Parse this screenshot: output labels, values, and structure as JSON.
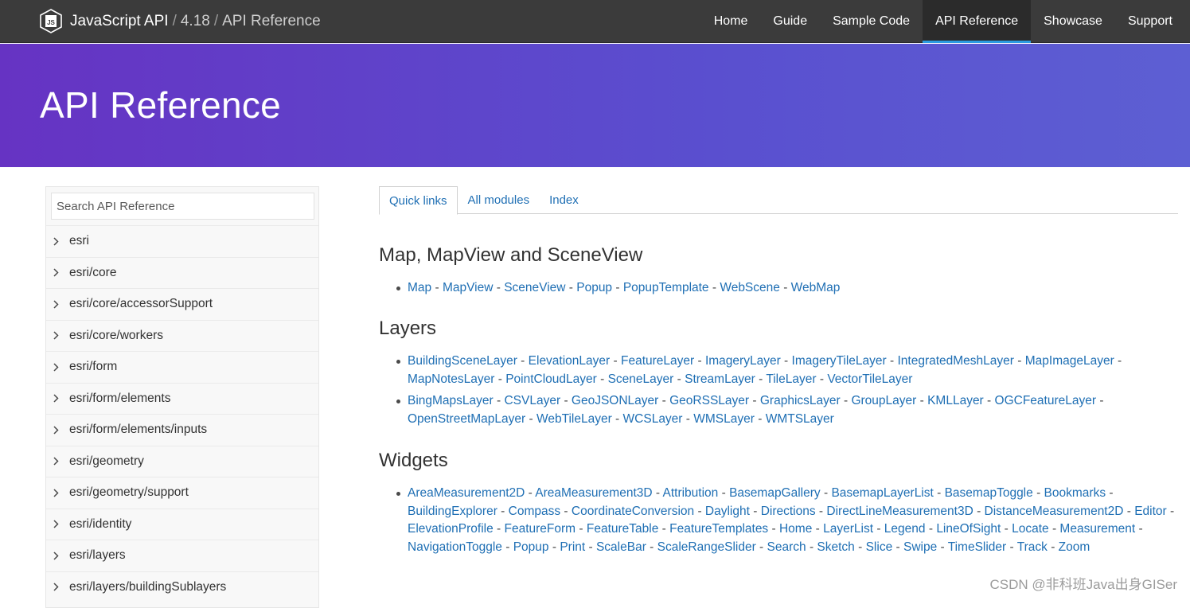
{
  "header": {
    "brand_title": "JavaScript API",
    "version": "4.18",
    "section": "API Reference",
    "separator": "/",
    "nav": [
      {
        "label": "Home",
        "active": false
      },
      {
        "label": "Guide",
        "active": false
      },
      {
        "label": "Sample Code",
        "active": false
      },
      {
        "label": "API Reference",
        "active": true
      },
      {
        "label": "Showcase",
        "active": false
      },
      {
        "label": "Support",
        "active": false
      }
    ]
  },
  "hero": {
    "title": "API Reference"
  },
  "sidebar": {
    "search_placeholder": "Search API Reference",
    "modules": [
      "esri",
      "esri/core",
      "esri/core/accessorSupport",
      "esri/core/workers",
      "esri/form",
      "esri/form/elements",
      "esri/form/elements/inputs",
      "esri/geometry",
      "esri/geometry/support",
      "esri/identity",
      "esri/layers",
      "esri/layers/buildingSublayers"
    ]
  },
  "main": {
    "tabs": [
      {
        "label": "Quick links",
        "active": true
      },
      {
        "label": "All modules",
        "active": false
      },
      {
        "label": "Index",
        "active": false
      }
    ],
    "sections": [
      {
        "title": "Map, MapView and SceneView",
        "groups": [
          [
            "Map",
            "MapView",
            "SceneView",
            "Popup",
            "PopupTemplate",
            "WebScene",
            "WebMap"
          ]
        ]
      },
      {
        "title": "Layers",
        "groups": [
          [
            "BuildingSceneLayer",
            "ElevationLayer",
            "FeatureLayer",
            "ImageryLayer",
            "ImageryTileLayer",
            "IntegratedMeshLayer",
            "MapImageLayer",
            "MapNotesLayer",
            "PointCloudLayer",
            "SceneLayer",
            "StreamLayer",
            "TileLayer",
            "VectorTileLayer"
          ],
          [
            "BingMapsLayer",
            "CSVLayer",
            "GeoJSONLayer",
            "GeoRSSLayer",
            "GraphicsLayer",
            "GroupLayer",
            "KMLLayer",
            "OGCFeatureLayer",
            "OpenStreetMapLayer",
            "WebTileLayer",
            "WCSLayer",
            "WMSLayer",
            "WMTSLayer"
          ]
        ]
      },
      {
        "title": "Widgets",
        "groups": [
          [
            "AreaMeasurement2D",
            "AreaMeasurement3D",
            "Attribution",
            "BasemapGallery",
            "BasemapLayerList",
            "BasemapToggle",
            "Bookmarks",
            "BuildingExplorer",
            "Compass",
            "CoordinateConversion",
            "Daylight",
            "Directions",
            "DirectLineMeasurement3D",
            "DistanceMeasurement2D",
            "Editor",
            "ElevationProfile",
            "FeatureForm",
            "FeatureTable",
            "FeatureTemplates",
            "Home",
            "LayerList",
            "Legend",
            "LineOfSight",
            "Locate",
            "Measurement",
            "NavigationToggle",
            "Popup",
            "Print",
            "ScaleBar",
            "ScaleRangeSlider",
            "Search",
            "Sketch",
            "Slice",
            "Swipe",
            "TimeSlider",
            "Track",
            "Zoom"
          ]
        ]
      }
    ],
    "link_separator": " - "
  },
  "watermark": "CSDN @非科班Java出身GISer",
  "colors": {
    "topbar": "#3b3b3b",
    "hero_start": "#6633c3",
    "hero_end": "#5d5fd3",
    "link": "#1f6fb4",
    "active_underline": "#2b9be0"
  },
  "icons": {
    "brand": "js-logo-icon",
    "module_expand": "chevron-right-icon"
  }
}
